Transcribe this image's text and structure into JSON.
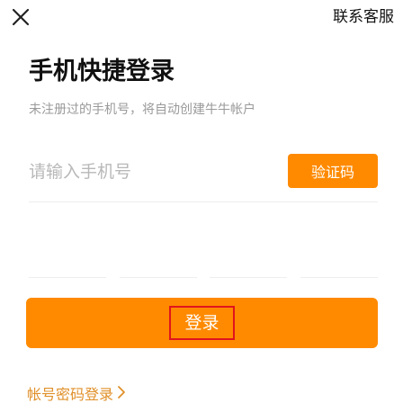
{
  "header": {
    "close_icon": "close-icon",
    "support_label": "联系客服"
  },
  "login": {
    "title": "手机快捷登录",
    "subtitle": "未注册过的手机号，将自动创建牛牛帐户",
    "phone_placeholder": "请输入手机号",
    "phone_value": "",
    "get_code_label": "验证码",
    "code_boxes": 4,
    "submit_label": "登录",
    "password_login_label": "帐号密码登录",
    "password_login_icon": "chevron-right-icon"
  },
  "colors": {
    "accent": "#ff8a00",
    "link": "#e0902a",
    "highlight_border": "#e1141d",
    "placeholder": "#b8b8b8",
    "subtitle": "#9a9a9a"
  }
}
